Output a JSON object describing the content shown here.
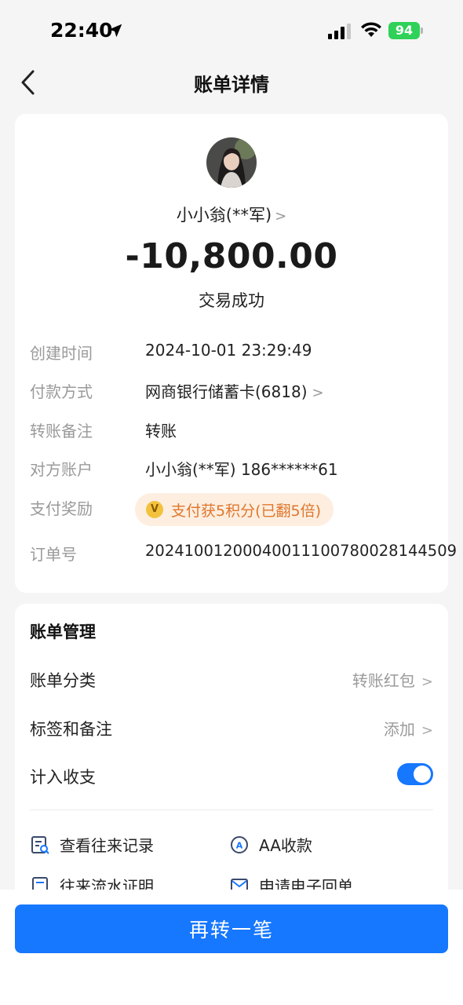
{
  "status_bar": {
    "time": "22:40",
    "battery": "94",
    "icons": [
      "location-arrow-icon",
      "signal-icon",
      "wifi-icon",
      "battery-icon"
    ]
  },
  "nav": {
    "title": "账单详情",
    "back_icon": "chevron-left-icon"
  },
  "transaction": {
    "payee": "小小翁(**军)",
    "amount": "-10,800.00",
    "status": "交易成功"
  },
  "details": {
    "created_time": {
      "label": "创建时间",
      "value": "2024-10-01 23:29:49"
    },
    "payment_method": {
      "label": "付款方式",
      "value": "网商银行储蓄卡(6818)"
    },
    "transfer_note": {
      "label": "转账备注",
      "value": "转账"
    },
    "counterparty": {
      "label": "对方账户",
      "value": "小小翁(**军) 186******61"
    },
    "reward": {
      "label": "支付奖励",
      "value": "支付获5积分(已翻5倍)",
      "coin": "V"
    },
    "order_no": {
      "label": "订单号",
      "value": "20241001200040011100780028144509"
    }
  },
  "manage": {
    "title": "账单管理",
    "category": {
      "label": "账单分类",
      "value": "转账红包"
    },
    "tags": {
      "label": "标签和备注",
      "value": "添加"
    },
    "include": {
      "label": "计入收支",
      "enabled": true
    },
    "actions": [
      {
        "label": "查看往来记录",
        "icon": "record-search-icon"
      },
      {
        "label": "AA收款",
        "icon": "aa-collect-icon"
      },
      {
        "label": "往来流水证明",
        "icon": "statement-icon"
      },
      {
        "label": "申请电子回单",
        "icon": "receipt-mail-icon"
      }
    ]
  },
  "footer": {
    "button_label": "再转一笔"
  },
  "colors": {
    "primary": "#1677ff",
    "reward_bg": "#fdeee0",
    "reward_text": "#e0762b",
    "battery": "#2fd158"
  }
}
